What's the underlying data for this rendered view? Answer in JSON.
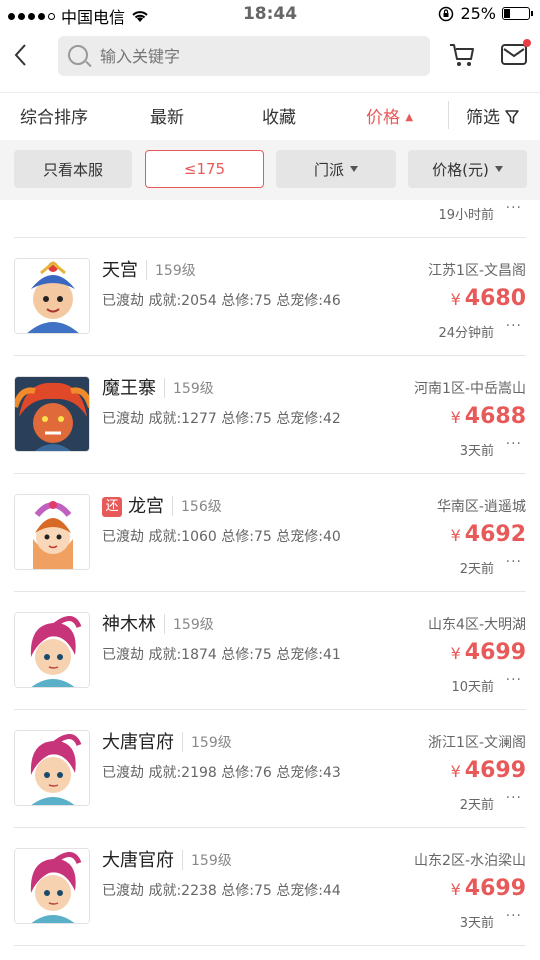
{
  "status_bar": {
    "carrier": "中国电信",
    "time": "18:44",
    "battery": "25%"
  },
  "search": {
    "placeholder": "输入关键字"
  },
  "sort": {
    "items": [
      "综合排序",
      "最新",
      "收藏",
      "价格",
      "筛选"
    ],
    "active_index": 3
  },
  "filters": {
    "server_only": "只看本服",
    "level": "≤175",
    "school": "门派",
    "price": "价格(元)"
  },
  "partial_row": {
    "time": "19小时前"
  },
  "rows": [
    {
      "name": "天宫",
      "level": "159级",
      "server": "江苏1区-文昌阁",
      "stats": "已渡劫 成就:2054 总修:75 总宠修:46",
      "price": "4680",
      "currency": "¥",
      "time": "24分钟前",
      "returned": false,
      "avatar": "monkey-king-blue",
      "more": "···"
    },
    {
      "name": "魔王寨",
      "level": "159级",
      "server": "河南1区-中岳嵩山",
      "stats": "已渡劫 成就:1277 总修:75 总宠修:42",
      "price": "4688",
      "currency": "¥",
      "time": "3天前",
      "returned": false,
      "avatar": "demon-red-hair",
      "more": "···"
    },
    {
      "name": "龙宫",
      "level": "156级",
      "server": "华南区-逍遥城",
      "stats": "已渡劫 成就:1060 总修:75 总宠修:40",
      "price": "4692",
      "currency": "¥",
      "time": "2天前",
      "returned": true,
      "badge": "还",
      "avatar": "dragon-princess",
      "more": "···"
    },
    {
      "name": "神木林",
      "level": "159级",
      "server": "山东4区-大明湖",
      "stats": "已渡劫 成就:1874 总修:75 总宠修:41",
      "price": "4699",
      "currency": "¥",
      "time": "10天前",
      "returned": false,
      "avatar": "pink-hair-boy",
      "more": "···"
    },
    {
      "name": "大唐官府",
      "level": "159级",
      "server": "浙江1区-文澜阁",
      "stats": "已渡劫 成就:2198 总修:76 总宠修:43",
      "price": "4699",
      "currency": "¥",
      "time": "2天前",
      "returned": false,
      "avatar": "pink-hair-boy",
      "more": "···"
    },
    {
      "name": "大唐官府",
      "level": "159级",
      "server": "山东2区-水泊梁山",
      "stats": "已渡劫 成就:2238 总修:75 总宠修:44",
      "price": "4699",
      "currency": "¥",
      "time": "3天前",
      "returned": false,
      "avatar": "pink-hair-boy",
      "more": "···"
    }
  ],
  "colors": {
    "accent": "#e85a5a",
    "chip_bg": "#e5e5e5",
    "filter_bg": "#f4f4f4"
  }
}
